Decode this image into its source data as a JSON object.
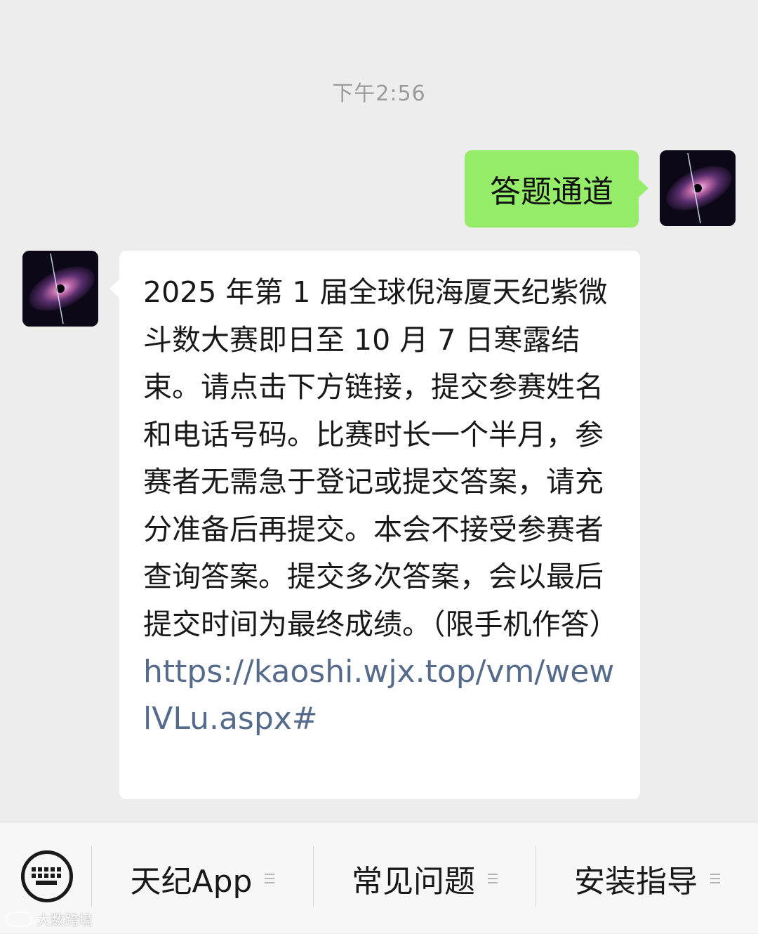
{
  "chat": {
    "timestamp": "下午2:56",
    "sent_message": "答题通道",
    "received_message": {
      "text": "2025 年第 1 届全球倪海厦天纪紫微斗数大赛即日至 10 月 7 日寒露结束。请点击下方链接，提交参赛姓名和电话号码。比赛时长一个半月，参赛者无需急于登记或提交答案，请充分准备后再提交。本会不接受参赛者查询答案。提交多次答案，会以最后提交时间为最终成绩。（限手机作答）",
      "link": "https://kaoshi.wjx.top/vm/wewlVLu.aspx#"
    }
  },
  "menu": {
    "keyboard_icon": "keyboard-icon",
    "items": [
      {
        "label": "天纪App",
        "icon": "menu-lines-icon"
      },
      {
        "label": "常见问题",
        "icon": "menu-lines-icon"
      },
      {
        "label": "安装指导",
        "icon": "menu-lines-icon"
      }
    ]
  },
  "watermark": {
    "text": "大数跨境"
  },
  "colors": {
    "background": "#ededed",
    "sent_bubble": "#95ec69",
    "received_bubble": "#ffffff",
    "link": "#566b8c"
  }
}
